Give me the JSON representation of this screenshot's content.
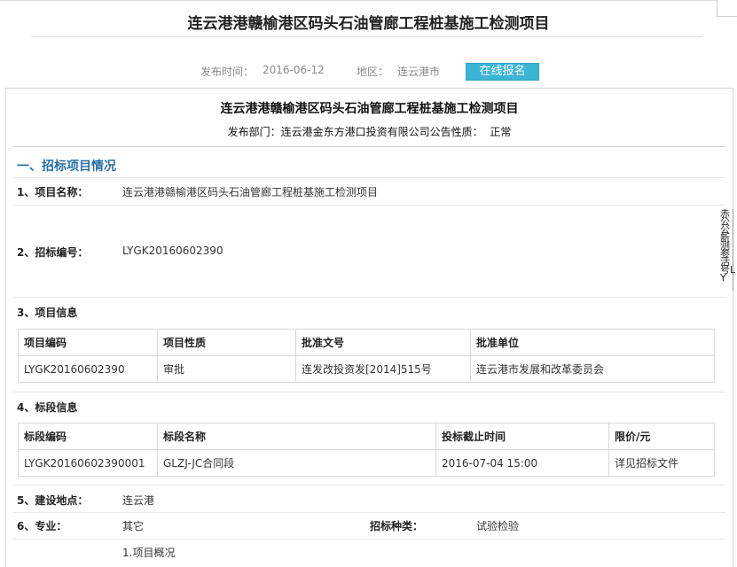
{
  "page_title": "连云港港赣榆港区码头石油管廊工程桩基施工检测项目",
  "meta": {
    "publish_time_label": "发布时间：",
    "publish_time": "2016-06-12",
    "region_label": "地区：",
    "region": "连云港市",
    "signup_button": "在线报名"
  },
  "notice": {
    "title": "连云港港赣榆港区码头石油管廊工程桩基施工检测项目",
    "dept_label": "发布部门：",
    "dept": "连云港金东方港口投资有限公司",
    "nature_label": "公告性质：",
    "nature": "正常",
    "section1_title": "一、招标项目情况",
    "project_name_label": "1、项目名称：",
    "project_name": "连云港港赣榆港区码头石油管廊工程桩基施工检测项目",
    "bid_no_label": "2、招标编号：",
    "bid_no": "LYGK20160602390",
    "project_info_label": "3、项目信息",
    "project_table": {
      "headers": [
        "项目编码",
        "项目性质",
        "批准文号",
        "批准单位"
      ],
      "row": [
        "LYGK20160602390",
        "审批",
        "连发改投资发[2014]515号",
        "连云港市发展和改革委员会"
      ]
    },
    "lot_info_label": "4、标段信息",
    "lot_table": {
      "headers": [
        "标段编码",
        "标段名称",
        "投标截止时间",
        "限价/元"
      ],
      "row": [
        "LYGK20160602390001",
        "GLZJ-JC合同段",
        "2016-07-04 15:00",
        "详见招标文件"
      ]
    },
    "site_label": "5、建设地点：",
    "site": "连云港",
    "major_label": "6、专业：",
    "major": "其它",
    "bid_type_label": "招标种类：",
    "bid_type": "试验检验",
    "overview": "1.项目概况"
  },
  "side_text": "赤公公新测参活号LY"
}
